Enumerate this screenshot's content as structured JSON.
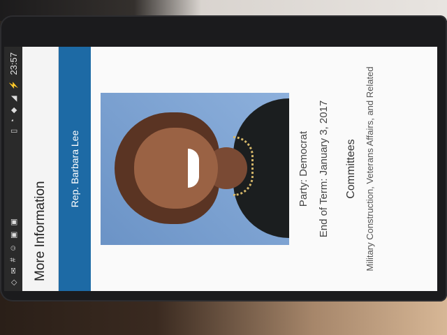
{
  "status_bar": {
    "time": "23:57",
    "icons": [
      "alarm-icon",
      "wifi-icon",
      "signal-icon",
      "battery-icon",
      "vibrate-icon",
      "photo-icon",
      "image-icon",
      "android-icon",
      "hash-icon",
      "mail-icon",
      "location-icon"
    ]
  },
  "app": {
    "title": "More Information"
  },
  "rep": {
    "name": "Rep. Barbara Lee",
    "party": "Party: Democrat",
    "term_end": "End of Term: January 3, 2017"
  },
  "committees": {
    "heading": "Committees",
    "items": [
      "Military Construction, Veterans Affairs, and Related"
    ]
  },
  "colors": {
    "banner": "#1d6aa5",
    "statusbar": "#2a2a2a",
    "background": "#fafafa"
  }
}
